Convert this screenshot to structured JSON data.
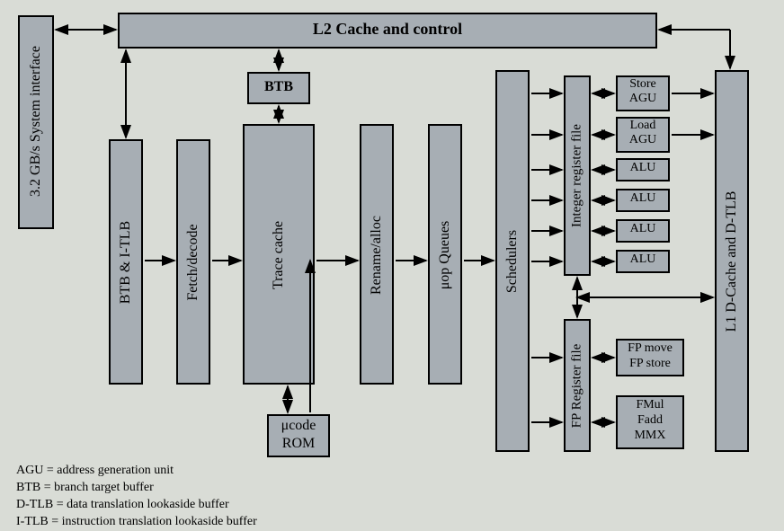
{
  "blocks": {
    "l2": "L2 Cache and control",
    "sysif": "3.2 GB/s System interface",
    "btb_itlb": "BTB & I-TLB",
    "fetch_decode": "Fetch/decode",
    "btb": "BTB",
    "trace_cache": "Trace cache",
    "ucode_rom_line1": "μcode",
    "ucode_rom_line2": "ROM",
    "rename_alloc": "Rename/alloc",
    "uop_queues": "μop Queues",
    "schedulers": "Schedulers",
    "int_reg_file": "Integer register file",
    "fp_reg_file": "FP Register file",
    "store_agu_line1": "Store",
    "store_agu_line2": "AGU",
    "load_agu_line1": "Load",
    "load_agu_line2": "AGU",
    "alu": "ALU",
    "fpmove_line1": "FP move",
    "fpmove_line2": "FP store",
    "fmul_line1": "FMul",
    "fmul_line2": "Fadd",
    "fmul_line3": "MMX",
    "l1_dcache": "L1 D-Cache and D-TLB"
  },
  "legend": {
    "agu": "AGU   = address generation unit",
    "btb": "BTB    = branch target buffer",
    "dtlb": "D-TLB = data translation lookaside buffer",
    "itlb": "I-TLB  = instruction translation lookaside buffer"
  }
}
